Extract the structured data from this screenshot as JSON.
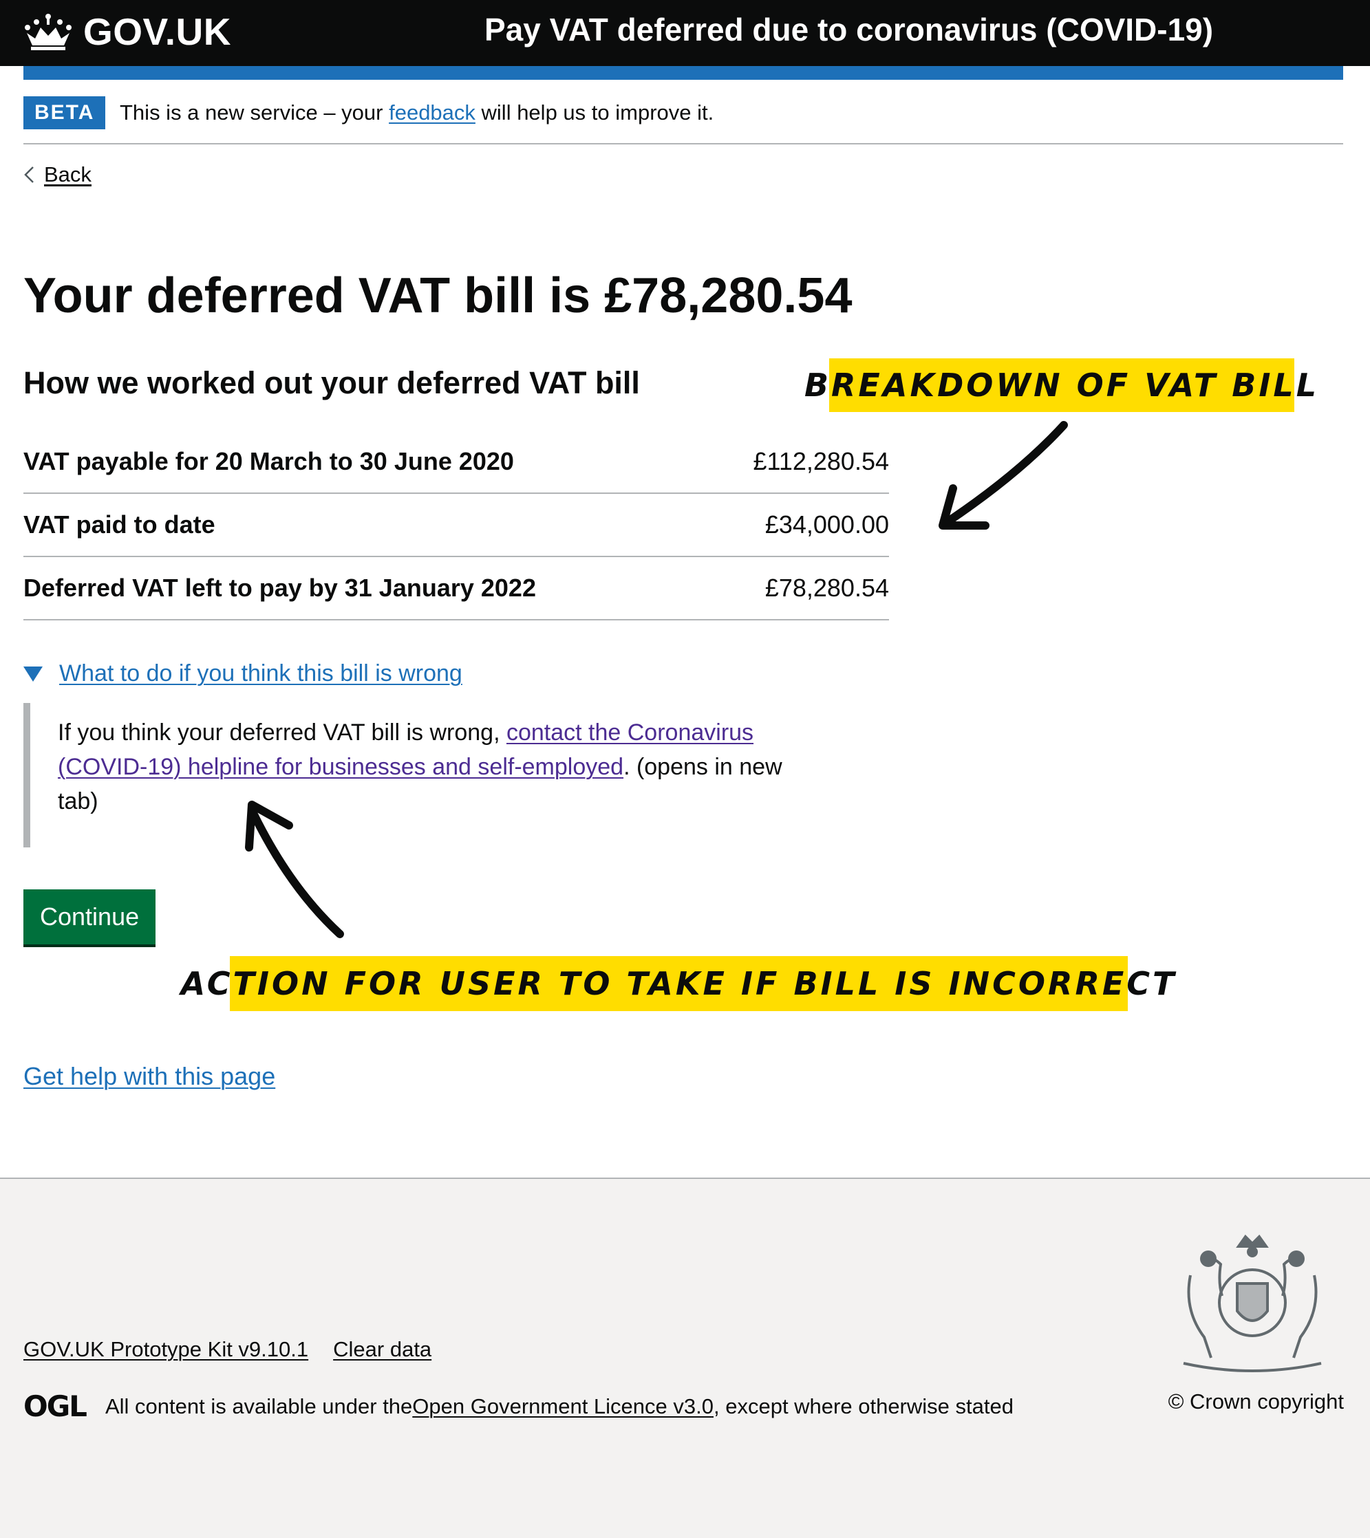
{
  "header": {
    "logo_text": "GOV.UK",
    "service_name": "Pay VAT deferred due to coronavirus (COVID-19)"
  },
  "phase_banner": {
    "tag": "BETA",
    "text_before": "This is a new service – your ",
    "link": "feedback",
    "text_after": " will help us to improve it."
  },
  "back_link": "Back",
  "page_title": "Your deferred VAT bill is £78,280.54",
  "section_heading": "How we worked out your deferred VAT bill",
  "summary_rows": [
    {
      "key": "VAT payable for 20 March to 30 June 2020",
      "value": "£112,280.54"
    },
    {
      "key": "VAT paid to date",
      "value": "£34,000.00"
    },
    {
      "key": "Deferred VAT left to pay by 31 January 2022",
      "value": "£78,280.54"
    }
  ],
  "details": {
    "summary": "What to do if you think this bill is wrong",
    "body_before": "If you think your deferred VAT bill is wrong, ",
    "body_link": "contact the Coronavirus (COVID-19) helpline for businesses and self-employed",
    "body_after": ". (opens in new tab)"
  },
  "continue_button": "Continue",
  "help_link": "Get help with this page",
  "annotations": {
    "breakdown": "BREAKDOWN OF VAT BILL",
    "action": "ACTION FOR USER TO TAKE IF BILL IS INCORRECT"
  },
  "footer": {
    "links": [
      "GOV.UK Prototype Kit v9.10.1",
      "Clear data"
    ],
    "ogl_logo": "OGL",
    "licence_before": "All content is available under the ",
    "licence_link": "Open Government Licence v3.0",
    "licence_after": ", except where otherwise stated",
    "copyright": "© Crown copyright"
  },
  "colors": {
    "header_bg": "#0b0c0c",
    "brand_blue": "#1d70b8",
    "button_green": "#00703c",
    "annotation_yellow": "#ffdd00",
    "visited_link": "#4c2c92",
    "footer_bg": "#f3f2f1"
  }
}
